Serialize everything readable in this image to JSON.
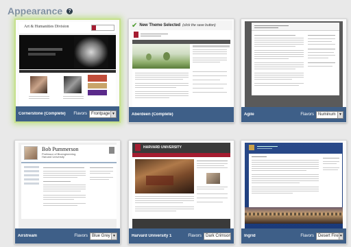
{
  "header": {
    "title": "Appearance",
    "help_icon": "help-icon"
  },
  "themes": [
    {
      "name": "Cornerstone (Complete)",
      "flavors_label": "Flavors",
      "flavor": "Frontpage",
      "active": true,
      "site_title": "Art & Humanities Division"
    },
    {
      "name": "Aberdeen (Complete)",
      "new_selected": "New Theme Selected",
      "click_note": "(click the save button)",
      "active": false
    },
    {
      "name": "Agile",
      "flavors_label": "Flavors",
      "flavor": "Numinum",
      "active": false
    },
    {
      "name": "Airstream",
      "flavors_label": "Flavors",
      "flavor": "Blue Grey",
      "active": false,
      "site_title": "Bob Pummerson",
      "site_subtitle1": "Professor of Bioengineering",
      "site_subtitle2": "Harvard University"
    },
    {
      "name": "Harvard University 1",
      "flavors_label": "Flavors",
      "flavor": "Dark Crimson",
      "active": false,
      "site_title": "HARVARD UNIVERSITY"
    },
    {
      "name": "Ingrid",
      "flavors_label": "Flavors",
      "flavor": "Desert Fire",
      "active": false
    }
  ]
}
